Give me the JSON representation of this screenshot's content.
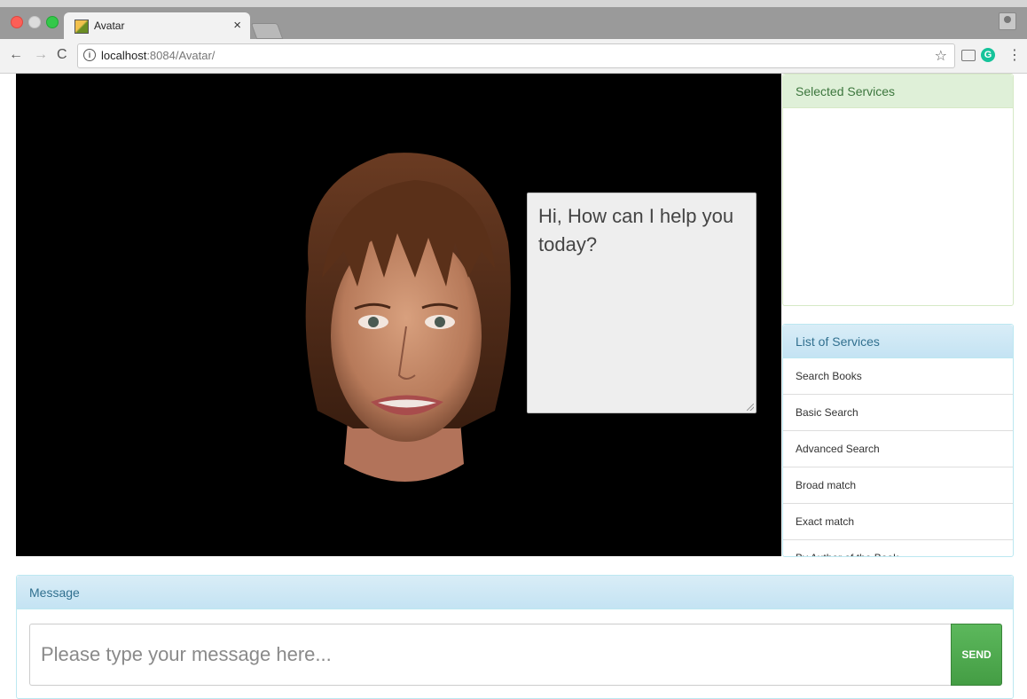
{
  "browser": {
    "tab_title": "Avatar",
    "tab_close": "×",
    "url_host": "localhost",
    "url_path": ":8084/Avatar/",
    "back_glyph": "←",
    "forward_glyph": "→",
    "reload_glyph": "C",
    "info_glyph": "i",
    "star_glyph": "☆",
    "menu_glyph": "⋮",
    "extension_glyph": "G"
  },
  "avatar": {
    "speech_text": "Hi, How can I help you today?"
  },
  "selected_services": {
    "heading": "Selected Services",
    "items": []
  },
  "services": {
    "heading": "List of Services",
    "items": [
      {
        "label": "Search Books"
      },
      {
        "label": "Basic Search"
      },
      {
        "label": "Advanced Search"
      },
      {
        "label": "Broad match"
      },
      {
        "label": "Exact match"
      },
      {
        "label": "By Author of the Book"
      }
    ]
  },
  "message": {
    "heading": "Message",
    "placeholder": "Please type your message here...",
    "send_label": "SEND"
  },
  "colors": {
    "stage_bg": "#000000",
    "send_green": "#5cb85c",
    "success_heading_bg": "#dff0d8",
    "info_heading_bg": "#d9edf7"
  }
}
